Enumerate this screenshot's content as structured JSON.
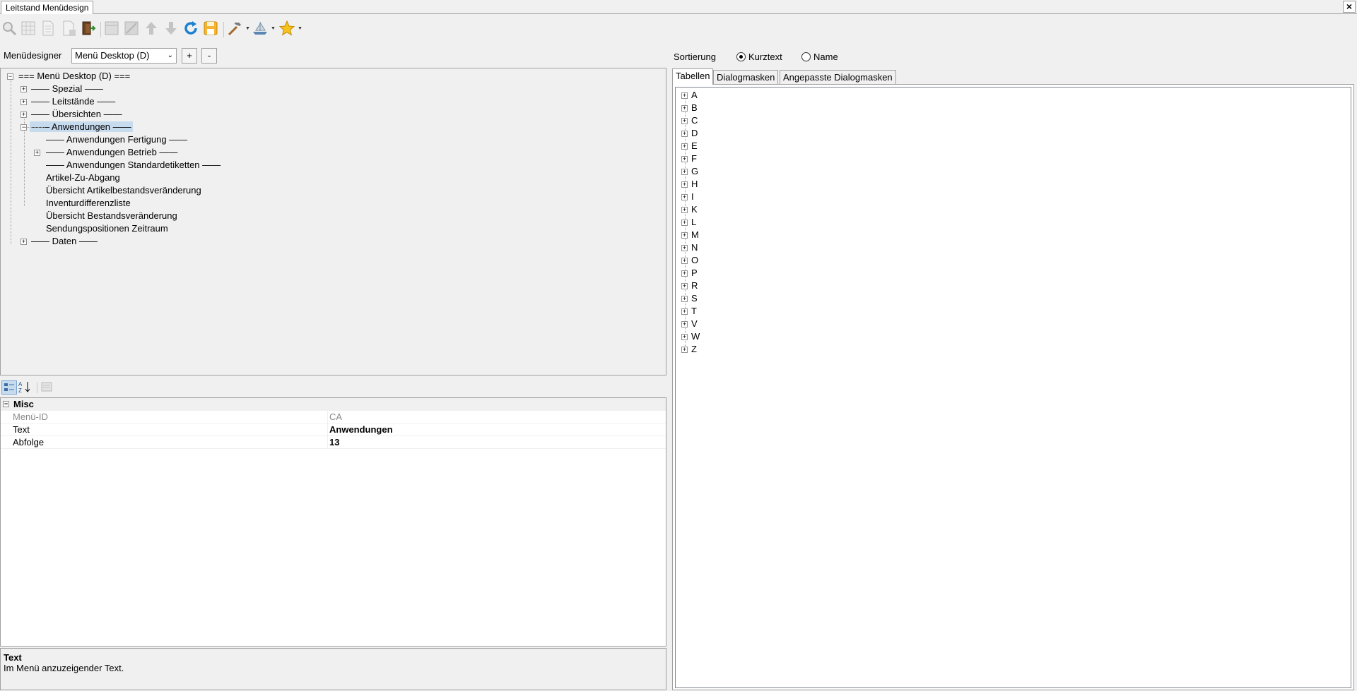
{
  "window": {
    "tab_title": "Leitstand Menüdesign",
    "close_label": "×"
  },
  "toolbar": {
    "icons": [
      "search-icon",
      "grid-icon",
      "page-icon",
      "page-add-icon",
      "exit-door-icon",
      "table-icon",
      "table-edit-icon",
      "arrow-up-icon",
      "arrow-down-icon",
      "refresh-icon",
      "save-icon",
      "hammer-icon",
      "ship-icon",
      "star-icon"
    ]
  },
  "menudesigner": {
    "label": "Menüdesigner",
    "selected": "Menü Desktop (D)",
    "add_label": "+",
    "remove_label": "-"
  },
  "tree": {
    "root": "=== Menü Desktop (D) ===",
    "items": [
      {
        "label": "—— Spezial ——",
        "level": 1,
        "expander": "+"
      },
      {
        "label": "—— Leitstände ——",
        "level": 1,
        "expander": "+"
      },
      {
        "label": "—— Übersichten ——",
        "level": 1,
        "expander": "+"
      },
      {
        "label": "—— Anwendungen ——",
        "level": 1,
        "expander": "−",
        "selected": true
      },
      {
        "label": "—— Anwendungen Fertigung ——",
        "level": 2,
        "expander": ""
      },
      {
        "label": "—— Anwendungen Betrieb ——",
        "level": 2,
        "expander": "+"
      },
      {
        "label": "—— Anwendungen Standardetiketten ——",
        "level": 2,
        "expander": ""
      },
      {
        "label": "Artikel-Zu-Abgang",
        "level": 2,
        "expander": ""
      },
      {
        "label": "Übersicht Artikelbestandsveränderung",
        "level": 2,
        "expander": ""
      },
      {
        "label": "Inventurdifferenzliste",
        "level": 2,
        "expander": ""
      },
      {
        "label": "Übersicht Bestandsveränderung",
        "level": 2,
        "expander": ""
      },
      {
        "label": "Sendungspositionen Zeitraum",
        "level": 2,
        "expander": ""
      },
      {
        "label": "—— Daten ——",
        "level": 1,
        "expander": "+"
      }
    ]
  },
  "property_grid": {
    "category": "Misc",
    "rows": [
      {
        "name": "Menü-ID",
        "value": "CA",
        "readonly": true
      },
      {
        "name": "Text",
        "value": "Anwendungen",
        "readonly": false
      },
      {
        "name": "Abfolge",
        "value": "13",
        "readonly": false
      }
    ],
    "help_title": "Text",
    "help_text": "Im Menü anzuzeigender Text."
  },
  "sorting": {
    "label": "Sortierung",
    "options": [
      {
        "label": "Kurztext",
        "checked": true
      },
      {
        "label": "Name",
        "checked": false
      }
    ]
  },
  "right_tabs": [
    "Tabellen",
    "Dialogmasken",
    "Angepasste Dialogmasken"
  ],
  "right_tree": [
    "A",
    "B",
    "C",
    "D",
    "E",
    "F",
    "G",
    "H",
    "I",
    "K",
    "L",
    "M",
    "N",
    "O",
    "P",
    "R",
    "S",
    "T",
    "V",
    "W",
    "Z"
  ]
}
